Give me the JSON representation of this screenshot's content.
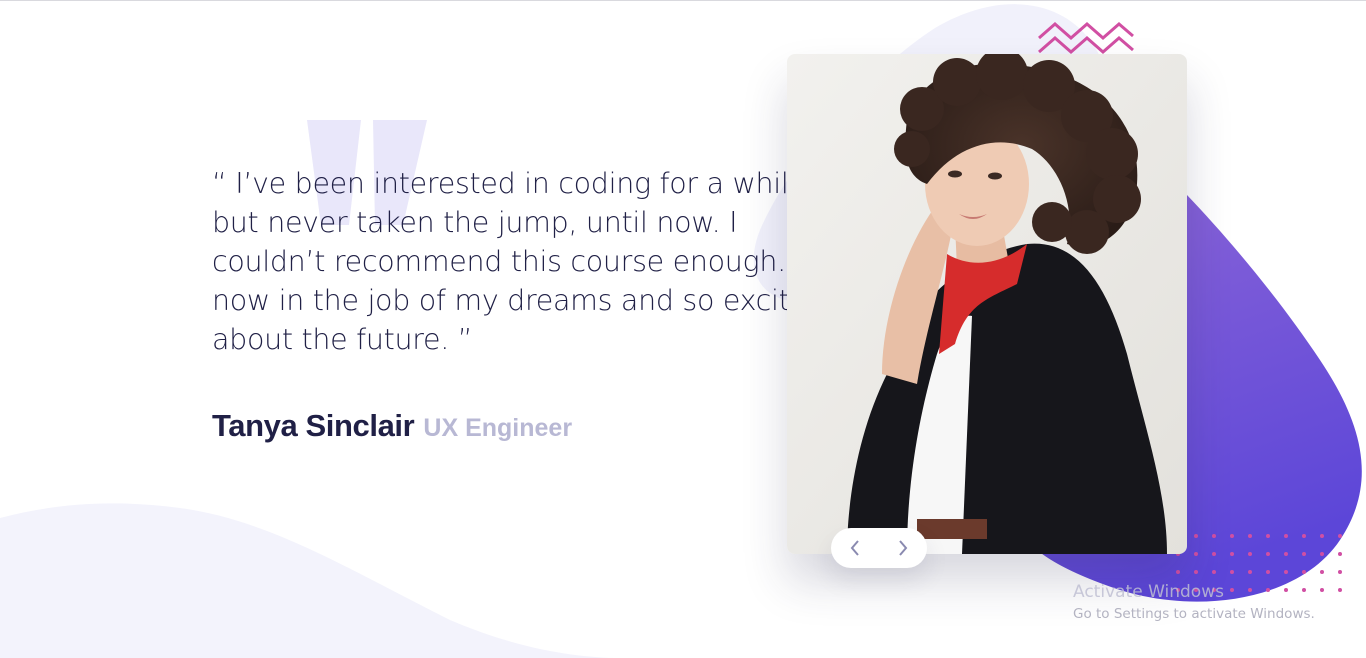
{
  "testimonial": {
    "quote": "“ I’ve been interested in coding for a while but never taken the jump, until now. I couldn’t recommend this course enough. I’m now in the job of my dreams and so excited about the future. ”",
    "author_name": "Tanya Sinclair",
    "author_role": "UX Engineer"
  },
  "photo": {
    "alt": "Portrait of Tanya Sinclair"
  },
  "slider_nav": {
    "prev_icon": "chevron-left-icon",
    "next_icon": "chevron-right-icon"
  },
  "os_overlay": {
    "title": "Activate Windows",
    "subtitle": "Go to Settings to activate Windows."
  },
  "colors": {
    "text_dark": "#202046",
    "text_muted": "#b8b8d4",
    "accent_purple": "#7a5bd6",
    "accent_pink": "#d14fa3",
    "light_bg_shape": "#f1f1fb"
  }
}
